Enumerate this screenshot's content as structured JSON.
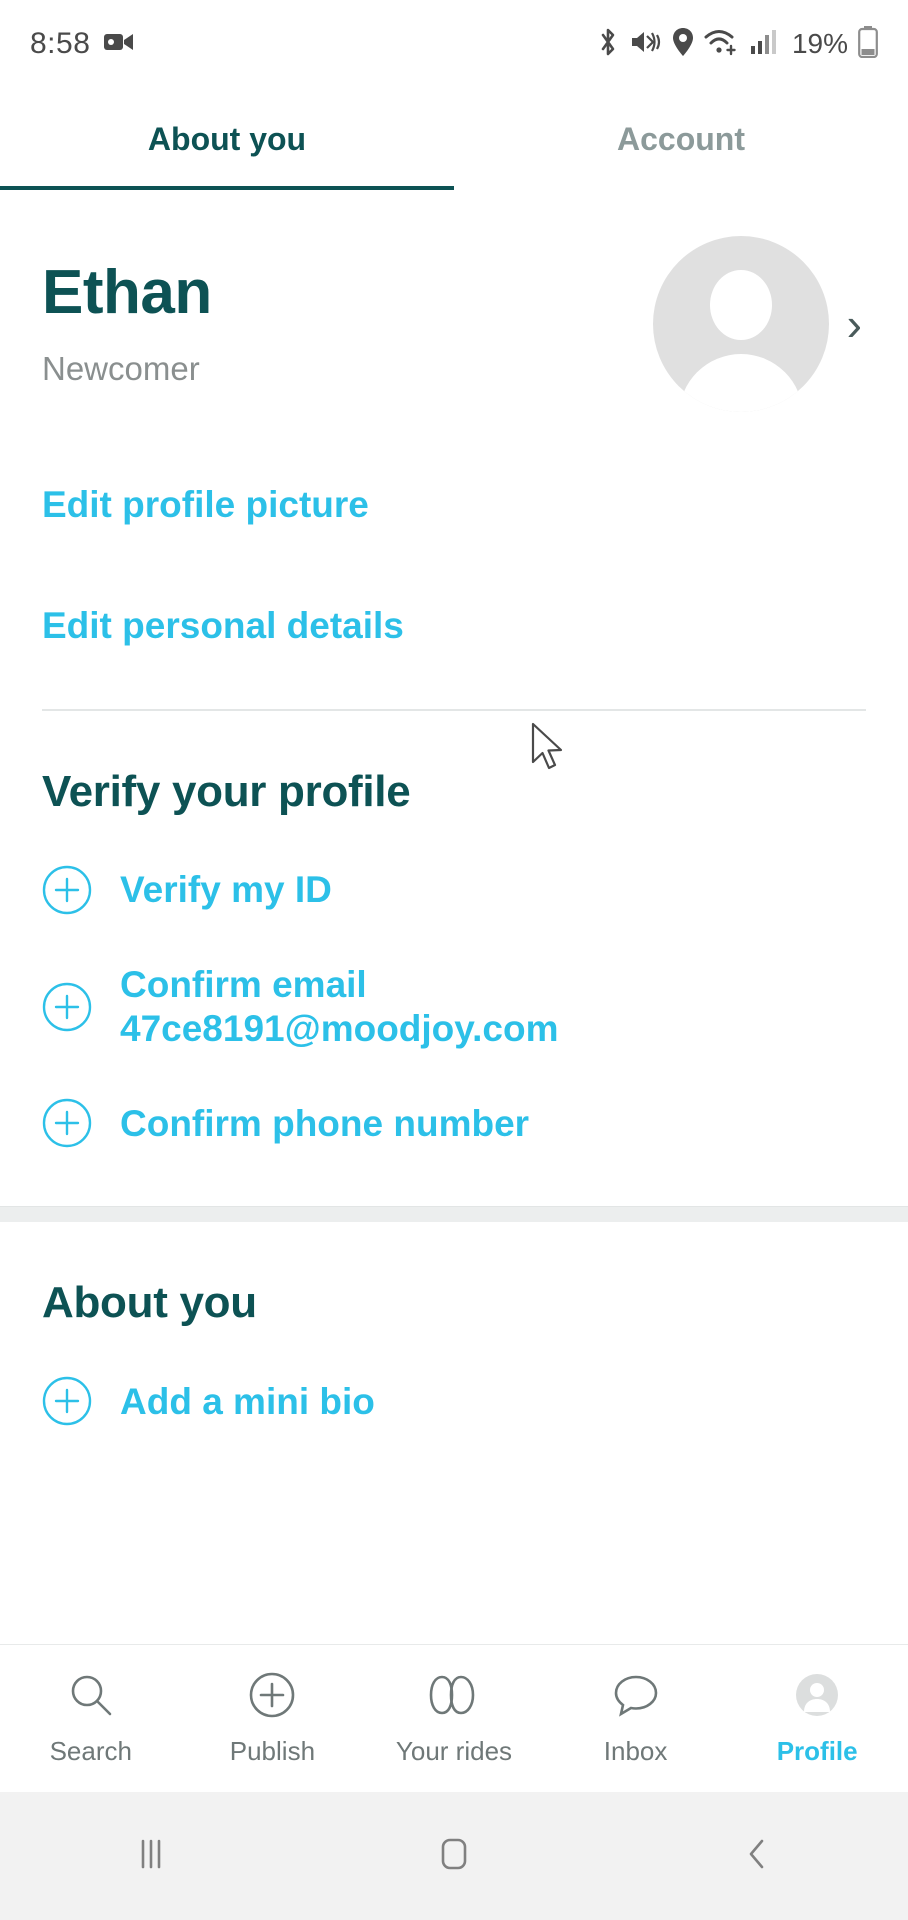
{
  "statusbar": {
    "time": "8:58",
    "battery_percent": "19%",
    "icons": [
      "video-camera-icon",
      "bluetooth-icon",
      "mute-vibrate-icon",
      "location-icon",
      "wifi-icon",
      "cellular-signal-icon",
      "battery-icon"
    ]
  },
  "tabs": [
    {
      "label": "About you",
      "active": true
    },
    {
      "label": "Account",
      "active": false
    }
  ],
  "profile": {
    "name": "Ethan",
    "status": "Newcomer",
    "avatar_icon": "person-avatar-icon",
    "chevron_icon": "chevron-right-icon"
  },
  "links": [
    {
      "label": "Edit profile picture"
    },
    {
      "label": "Edit personal details"
    }
  ],
  "verify_section": {
    "title": "Verify your profile",
    "items": [
      {
        "label": "Verify my ID",
        "icon": "plus-circle-icon"
      },
      {
        "label": "Confirm email 47ce8191@moodjoy.com",
        "icon": "plus-circle-icon"
      },
      {
        "label": "Confirm phone number",
        "icon": "plus-circle-icon"
      }
    ]
  },
  "about_section": {
    "title": "About you",
    "items": [
      {
        "label": "Add a mini bio",
        "icon": "plus-circle-icon"
      }
    ]
  },
  "bottom_nav": [
    {
      "label": "Search",
      "icon": "search-icon",
      "active": false
    },
    {
      "label": "Publish",
      "icon": "plus-circle-icon",
      "active": false
    },
    {
      "label": "Your rides",
      "icon": "rides-icon",
      "active": false
    },
    {
      "label": "Inbox",
      "icon": "chat-bubbles-icon",
      "active": false
    },
    {
      "label": "Profile",
      "icon": "person-icon",
      "active": true
    }
  ],
  "android_nav": [
    {
      "icon": "recents-icon"
    },
    {
      "icon": "home-icon"
    },
    {
      "icon": "back-icon"
    }
  ],
  "colors": {
    "brand_dark": "#0d5254",
    "accent_cyan": "#2cc0e8",
    "muted_gray": "#8a8f8f"
  }
}
